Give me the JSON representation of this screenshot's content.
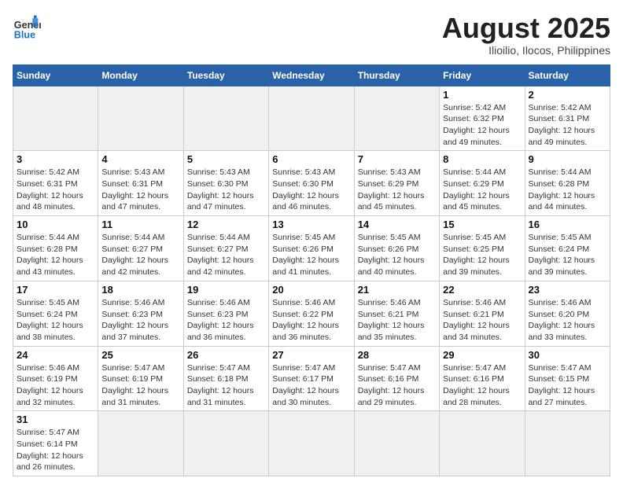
{
  "logo": {
    "general": "General",
    "blue": "Blue"
  },
  "title": "August 2025",
  "subtitle": "Ilioilio, Ilocos, Philippines",
  "weekdays": [
    "Sunday",
    "Monday",
    "Tuesday",
    "Wednesday",
    "Thursday",
    "Friday",
    "Saturday"
  ],
  "weeks": [
    [
      {
        "day": "",
        "info": "",
        "empty": true
      },
      {
        "day": "",
        "info": "",
        "empty": true
      },
      {
        "day": "",
        "info": "",
        "empty": true
      },
      {
        "day": "",
        "info": "",
        "empty": true
      },
      {
        "day": "",
        "info": "",
        "empty": true
      },
      {
        "day": "1",
        "info": "Sunrise: 5:42 AM\nSunset: 6:32 PM\nDaylight: 12 hours and 49 minutes."
      },
      {
        "day": "2",
        "info": "Sunrise: 5:42 AM\nSunset: 6:31 PM\nDaylight: 12 hours and 49 minutes."
      }
    ],
    [
      {
        "day": "3",
        "info": "Sunrise: 5:42 AM\nSunset: 6:31 PM\nDaylight: 12 hours and 48 minutes."
      },
      {
        "day": "4",
        "info": "Sunrise: 5:43 AM\nSunset: 6:31 PM\nDaylight: 12 hours and 47 minutes."
      },
      {
        "day": "5",
        "info": "Sunrise: 5:43 AM\nSunset: 6:30 PM\nDaylight: 12 hours and 47 minutes."
      },
      {
        "day": "6",
        "info": "Sunrise: 5:43 AM\nSunset: 6:30 PM\nDaylight: 12 hours and 46 minutes."
      },
      {
        "day": "7",
        "info": "Sunrise: 5:43 AM\nSunset: 6:29 PM\nDaylight: 12 hours and 45 minutes."
      },
      {
        "day": "8",
        "info": "Sunrise: 5:44 AM\nSunset: 6:29 PM\nDaylight: 12 hours and 45 minutes."
      },
      {
        "day": "9",
        "info": "Sunrise: 5:44 AM\nSunset: 6:28 PM\nDaylight: 12 hours and 44 minutes."
      }
    ],
    [
      {
        "day": "10",
        "info": "Sunrise: 5:44 AM\nSunset: 6:28 PM\nDaylight: 12 hours and 43 minutes."
      },
      {
        "day": "11",
        "info": "Sunrise: 5:44 AM\nSunset: 6:27 PM\nDaylight: 12 hours and 42 minutes."
      },
      {
        "day": "12",
        "info": "Sunrise: 5:44 AM\nSunset: 6:27 PM\nDaylight: 12 hours and 42 minutes."
      },
      {
        "day": "13",
        "info": "Sunrise: 5:45 AM\nSunset: 6:26 PM\nDaylight: 12 hours and 41 minutes."
      },
      {
        "day": "14",
        "info": "Sunrise: 5:45 AM\nSunset: 6:26 PM\nDaylight: 12 hours and 40 minutes."
      },
      {
        "day": "15",
        "info": "Sunrise: 5:45 AM\nSunset: 6:25 PM\nDaylight: 12 hours and 39 minutes."
      },
      {
        "day": "16",
        "info": "Sunrise: 5:45 AM\nSunset: 6:24 PM\nDaylight: 12 hours and 39 minutes."
      }
    ],
    [
      {
        "day": "17",
        "info": "Sunrise: 5:45 AM\nSunset: 6:24 PM\nDaylight: 12 hours and 38 minutes."
      },
      {
        "day": "18",
        "info": "Sunrise: 5:46 AM\nSunset: 6:23 PM\nDaylight: 12 hours and 37 minutes."
      },
      {
        "day": "19",
        "info": "Sunrise: 5:46 AM\nSunset: 6:23 PM\nDaylight: 12 hours and 36 minutes."
      },
      {
        "day": "20",
        "info": "Sunrise: 5:46 AM\nSunset: 6:22 PM\nDaylight: 12 hours and 36 minutes."
      },
      {
        "day": "21",
        "info": "Sunrise: 5:46 AM\nSunset: 6:21 PM\nDaylight: 12 hours and 35 minutes."
      },
      {
        "day": "22",
        "info": "Sunrise: 5:46 AM\nSunset: 6:21 PM\nDaylight: 12 hours and 34 minutes."
      },
      {
        "day": "23",
        "info": "Sunrise: 5:46 AM\nSunset: 6:20 PM\nDaylight: 12 hours and 33 minutes."
      }
    ],
    [
      {
        "day": "24",
        "info": "Sunrise: 5:46 AM\nSunset: 6:19 PM\nDaylight: 12 hours and 32 minutes."
      },
      {
        "day": "25",
        "info": "Sunrise: 5:47 AM\nSunset: 6:19 PM\nDaylight: 12 hours and 31 minutes."
      },
      {
        "day": "26",
        "info": "Sunrise: 5:47 AM\nSunset: 6:18 PM\nDaylight: 12 hours and 31 minutes."
      },
      {
        "day": "27",
        "info": "Sunrise: 5:47 AM\nSunset: 6:17 PM\nDaylight: 12 hours and 30 minutes."
      },
      {
        "day": "28",
        "info": "Sunrise: 5:47 AM\nSunset: 6:16 PM\nDaylight: 12 hours and 29 minutes."
      },
      {
        "day": "29",
        "info": "Sunrise: 5:47 AM\nSunset: 6:16 PM\nDaylight: 12 hours and 28 minutes."
      },
      {
        "day": "30",
        "info": "Sunrise: 5:47 AM\nSunset: 6:15 PM\nDaylight: 12 hours and 27 minutes."
      }
    ],
    [
      {
        "day": "31",
        "info": "Sunrise: 5:47 AM\nSunset: 6:14 PM\nDaylight: 12 hours and 26 minutes."
      },
      {
        "day": "",
        "info": "",
        "empty": true
      },
      {
        "day": "",
        "info": "",
        "empty": true
      },
      {
        "day": "",
        "info": "",
        "empty": true
      },
      {
        "day": "",
        "info": "",
        "empty": true
      },
      {
        "day": "",
        "info": "",
        "empty": true
      },
      {
        "day": "",
        "info": "",
        "empty": true
      }
    ]
  ]
}
